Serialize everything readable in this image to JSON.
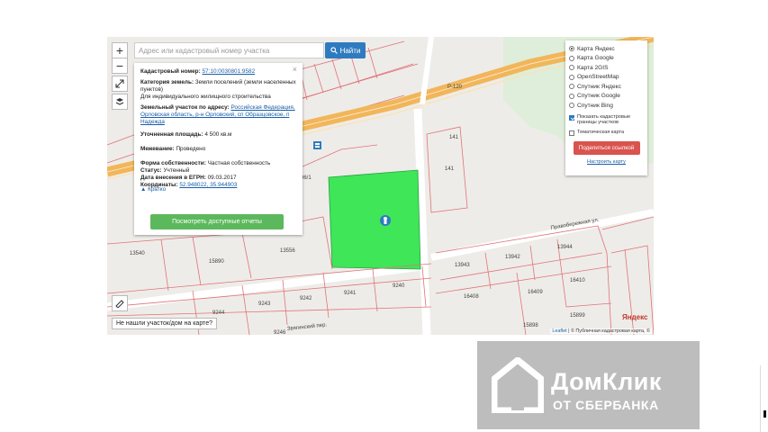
{
  "map": {
    "search": {
      "placeholder": "Адрес или кадастровый номер участка",
      "button_label": "Найти"
    },
    "zoom": {
      "in": "+",
      "out": "−"
    },
    "info": {
      "close": "×",
      "cadastral_label": "Кадастровый номер:",
      "cadastral_value": "57:10:0030801:9582",
      "category_label": "Категория земель:",
      "category_value": "Земли поселений (земли населенных пунктов)",
      "usage_value": "Для индивидуального жилищного строительства",
      "address_label": "Земельный участок по адресу:",
      "address_value": "Российская Федерация, Орловская область, р-н Орловский, сп Образцовское, п Надежда",
      "area_label": "Уточненная площадь:",
      "area_value": "4 500 кв.м",
      "survey_label": "Межевание:",
      "survey_value": "Проведено",
      "ownership_label": "Форма собственности:",
      "ownership_value": "Частная собственность",
      "status_label": "Статус:",
      "status_value": "Учтенный",
      "egrn_label": "Дата внесения в ЕГРН:",
      "egrn_value": "09.03.2017",
      "coords_label": "Координаты:",
      "coords_value": "52.948022, 35.944903",
      "collapse": "Кратко",
      "report_button": "Посмотреть доступные отчеты"
    },
    "layers": {
      "options": [
        "Карта Яндекс",
        "Карта Google",
        "Карта 2GIS",
        "OpenStreetMap",
        "Спутник Яндекс",
        "Спутник Google",
        "Спутник Bing"
      ],
      "selected": "Карта Яндекс",
      "show_boundaries": "Показать кадастровые границы участков",
      "thematic": "Тематическая карта",
      "share_button": "Поделиться ссылкой",
      "customize_link": "Настроить карту"
    },
    "not_found": "Не нашли участок/дом на карте?",
    "attribution_leaflet": "Leaflet",
    "attribution_text": "| © Публичная кадастровая карта, ©",
    "yandex_logo": "Яндекс",
    "labels": {
      "road_r120": "Р-120",
      "p141a": "141",
      "p141b": "141",
      "p96": "96/1",
      "p13556": "13556",
      "p13540": "13540",
      "p15890": "15890",
      "p9244": "9244",
      "p9243": "9243",
      "p9242": "9242",
      "p9241": "9241",
      "p9240": "9240",
      "p9246": "9246",
      "p13943": "13943",
      "p13942": "13942",
      "p13944": "13944",
      "p16408": "16408",
      "p16409": "16409",
      "p16410": "16410",
      "p15898": "15898",
      "p15899": "15899",
      "street1": "Правобережная ул.",
      "street2": "Звягинский пер."
    }
  },
  "watermark": {
    "brand": "ДомКлик",
    "sub": "ОТ СБЕРБАНКА"
  },
  "colors": {
    "parcel_selected": "#3ee658",
    "road": "#f2b65a",
    "boundary": "#e0737a",
    "search_button": "#2f7bc0",
    "share_button": "#d9534f",
    "report_button": "#5cb85c"
  }
}
